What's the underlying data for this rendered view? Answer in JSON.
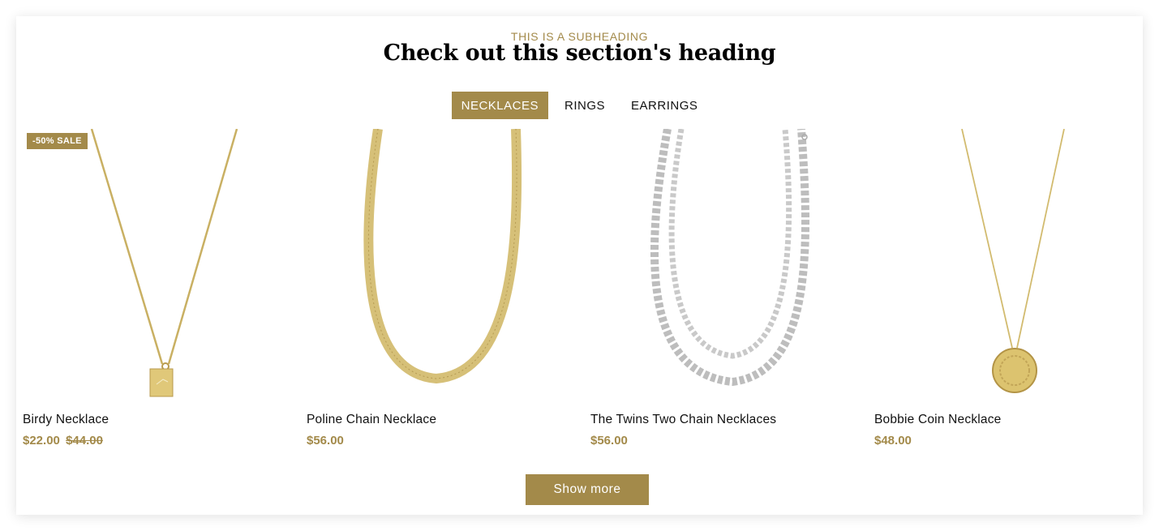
{
  "section": {
    "subheading": "THIS IS A SUBHEADING",
    "heading": "Check out this section's heading"
  },
  "tabs": [
    {
      "label": "NECKLACES",
      "active": true
    },
    {
      "label": "RINGS",
      "active": false
    },
    {
      "label": "EARRINGS",
      "active": false
    }
  ],
  "products": [
    {
      "name": "Birdy Necklace",
      "price": "$22.00",
      "compare_price": "$44.00",
      "badge": "-50% SALE",
      "image": "gold-pendant-necklace"
    },
    {
      "name": "Poline Chain Necklace",
      "price": "$56.00",
      "image": "gold-herringbone-chain"
    },
    {
      "name": "The Twins Two Chain Necklaces",
      "price": "$56.00",
      "image": "silver-curb-chains"
    },
    {
      "name": "Bobbie Coin Necklace",
      "price": "$48.00",
      "image": "gold-coin-necklace"
    }
  ],
  "show_more_label": "Show more",
  "colors": {
    "accent": "#a38a4a",
    "gold": "#d8c27a",
    "silver": "#c4c4c4"
  }
}
